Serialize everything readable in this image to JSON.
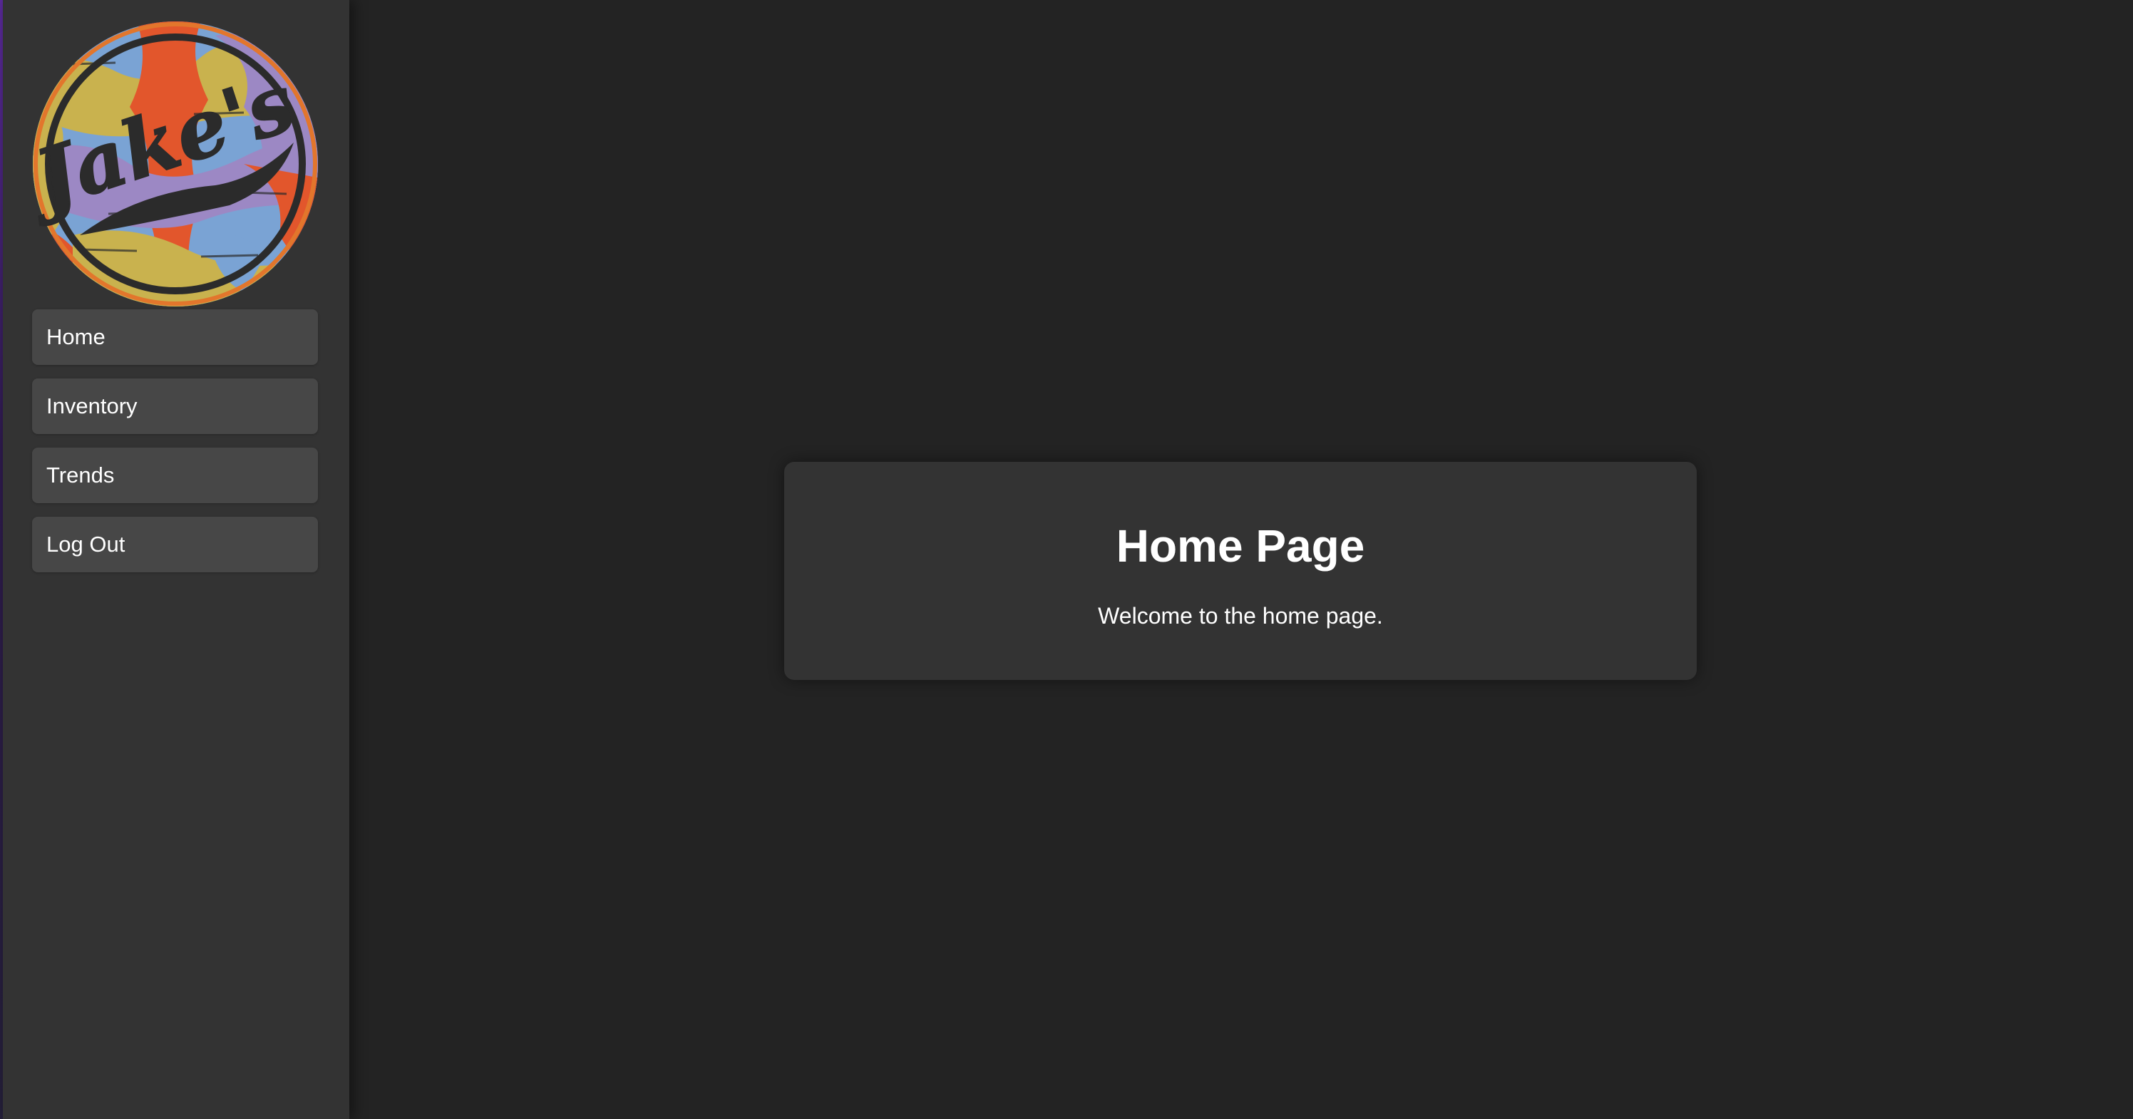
{
  "sidebar": {
    "logo": {
      "name": "jakes-logo",
      "text": "Jake's",
      "colors": [
        "#7aa3d4",
        "#c9b24e",
        "#e2562c",
        "#9c88c4",
        "#2b2b2b"
      ]
    },
    "items": [
      {
        "label": "Home"
      },
      {
        "label": "Inventory"
      },
      {
        "label": "Trends"
      },
      {
        "label": "Log Out"
      }
    ]
  },
  "main": {
    "card": {
      "title": "Home Page",
      "message": "Welcome to the home page."
    }
  },
  "colors": {
    "background": "#232323",
    "sidebar": "#333333",
    "nav_item": "#474747",
    "card": "#333333",
    "text": "#ffffff"
  }
}
